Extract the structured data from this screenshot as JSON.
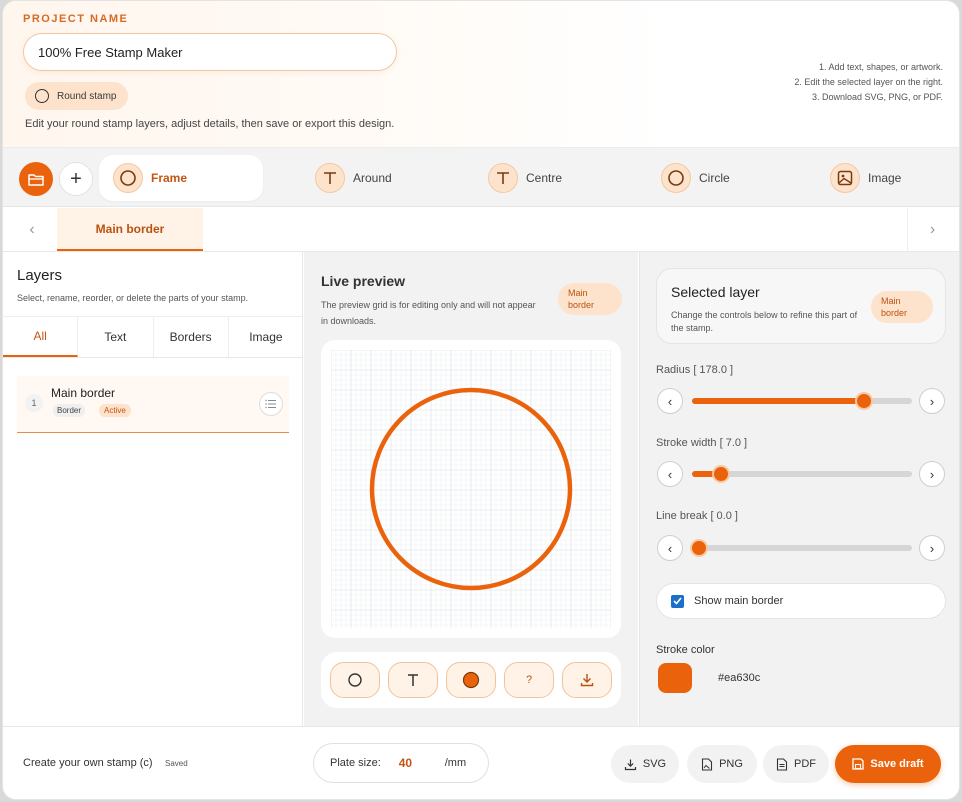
{
  "header": {
    "project_label": "PROJECT NAME",
    "project_name": "100% Free Stamp Maker",
    "stamp_type": "Round stamp",
    "description": "Edit your round stamp layers, adjust details, then save or export this design.",
    "steps": [
      "1. Add text, shapes, or artwork.",
      "2. Edit the selected layer on the right.",
      "3. Download SVG, PNG, or PDF."
    ]
  },
  "toolbar": {
    "tools": [
      {
        "label": "Frame",
        "icon": "circle-icon",
        "active": true
      },
      {
        "label": "Around",
        "icon": "text-icon"
      },
      {
        "label": "Centre",
        "icon": "text-icon"
      },
      {
        "label": "Circle",
        "icon": "circle-icon"
      },
      {
        "label": "Image",
        "icon": "image-icon"
      }
    ]
  },
  "layer_tabs": {
    "active_tab": "Main border"
  },
  "layers_panel": {
    "title": "Layers",
    "subtitle": "Select, rename, reorder, or delete the parts of your stamp.",
    "filters": [
      "All",
      "Text",
      "Borders",
      "Image"
    ],
    "active_filter": "All",
    "items": [
      {
        "index": "1",
        "name": "Main border",
        "kind": "Border",
        "status": "Active"
      }
    ]
  },
  "preview": {
    "title": "Live preview",
    "subtitle": "The preview grid is for editing only and will not appear in downloads.",
    "badge": "Main border",
    "stroke_color": "#ea630c",
    "shape_buttons": [
      {
        "name": "circle-icon"
      },
      {
        "name": "text-icon"
      },
      {
        "name": "filled-circle-icon"
      },
      {
        "name": "help-icon",
        "label": "?"
      },
      {
        "name": "download-icon"
      }
    ]
  },
  "selected_layer": {
    "title": "Selected layer",
    "subtitle": "Change the controls below to refine this part of the stamp.",
    "badge": "Main border",
    "controls": [
      {
        "label": "Radius",
        "value": "[ 178.0 ]",
        "fraction": 0.78
      },
      {
        "label": "Stroke width",
        "value": "[ 7.0 ]",
        "fraction": 0.13
      },
      {
        "label": "Line break",
        "value": "[ 0.0 ]",
        "fraction": 0.03
      }
    ],
    "show_border_label": "Show main border",
    "show_border_checked": true,
    "stroke_color_label": "Stroke color",
    "stroke_color_hex": "#ea630c"
  },
  "footer": {
    "brand": "Create your own stamp (c)",
    "saved": "Saved",
    "plate_label": "Plate size:",
    "plate_value": "40",
    "plate_unit": "/mm",
    "export": [
      {
        "label": "SVG",
        "icon": "download-icon"
      },
      {
        "label": "PNG",
        "icon": "file-image-icon"
      },
      {
        "label": "PDF",
        "icon": "file-text-icon"
      }
    ],
    "save_label": "Save draft"
  },
  "colors": {
    "accent": "#ea630c",
    "accent_soft": "#fde3cc"
  }
}
